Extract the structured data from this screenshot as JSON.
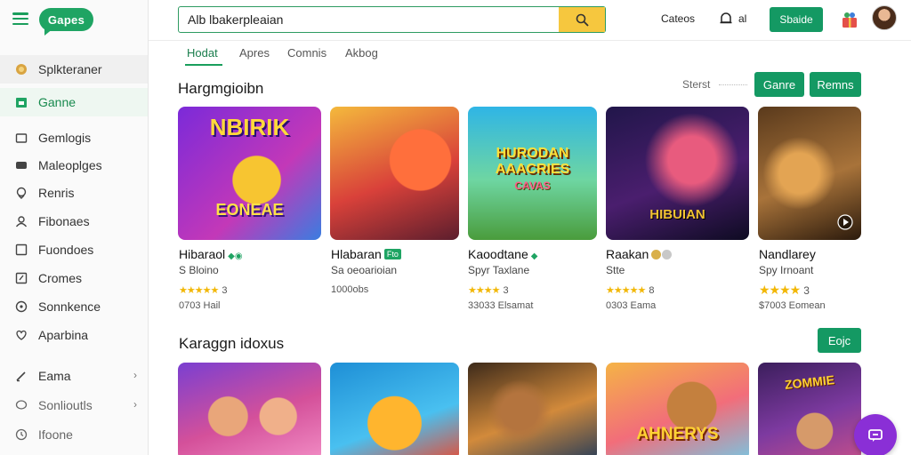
{
  "header": {
    "logo": "Gapes",
    "search_value": "Alb lbakerpleaian",
    "link": "Cateos",
    "small_link": "al",
    "primary_button": "Sbaide"
  },
  "sidebar": {
    "items": [
      {
        "label": "Splkteraner",
        "icon": "coin-icon"
      },
      {
        "label": "Ganne",
        "icon": "store-icon"
      },
      {
        "label": "Gemlogis",
        "icon": "folder-icon"
      },
      {
        "label": "Maleoplges",
        "icon": "gamepad-icon"
      },
      {
        "label": "Renris",
        "icon": "location-icon"
      },
      {
        "label": "Fibonaes",
        "icon": "user-icon"
      },
      {
        "label": "Fuondoes",
        "icon": "box-icon"
      },
      {
        "label": "Cromes",
        "icon": "edit-icon"
      },
      {
        "label": "Sonnkence",
        "icon": "compass-icon"
      },
      {
        "label": "Aparbina",
        "icon": "heart-icon"
      },
      {
        "label": "Eama",
        "icon": "pen-icon"
      },
      {
        "label": "Sonlioutls",
        "icon": "chat-icon"
      },
      {
        "label": "Ifoone",
        "icon": "clock-icon"
      }
    ]
  },
  "tabs": [
    "Hodat",
    "Apres",
    "Comnis",
    "Akbog"
  ],
  "section1": {
    "title": "Hargmgioibn",
    "filter": "Sterst",
    "button1": "Ganre",
    "button2": "Remns",
    "cards": [
      {
        "thumb_text": "NBIRIK",
        "thumb_sub": "EONEAE",
        "title": "Hibaraol",
        "sub": "S Bloino",
        "rating": "3",
        "meta": "0703 Hail"
      },
      {
        "thumb_text": "",
        "thumb_sub": "",
        "title": "Hlabaran",
        "badge": "Fto",
        "sub": "Sa oeoarioian",
        "rating": "",
        "meta": "1000obs"
      },
      {
        "thumb_text": "HURODAN AAACRIES",
        "thumb_sub": "CAVAS",
        "title": "Kaoodtane",
        "sub": "Spyr Taxlane",
        "rating": "3",
        "meta": "33033 Elsamat"
      },
      {
        "thumb_text": "HIBUIAN",
        "thumb_sub": "",
        "title": "Raakan",
        "sub": "Stte",
        "rating": "8",
        "meta": "0303 Eama"
      },
      {
        "thumb_text": "",
        "thumb_sub": "",
        "title": "Nandlarey",
        "sub": "Spy Irnoant",
        "rating": "3",
        "meta": "$7003 Eomean"
      }
    ]
  },
  "section2": {
    "title": "Karaggn idoxus",
    "button": "Eojc",
    "cards": [
      {
        "thumb_text": ""
      },
      {
        "thumb_text": ""
      },
      {
        "thumb_text": ""
      },
      {
        "thumb_text": "AHNERYS"
      },
      {
        "thumb_text": "ZOMMIE"
      }
    ]
  }
}
